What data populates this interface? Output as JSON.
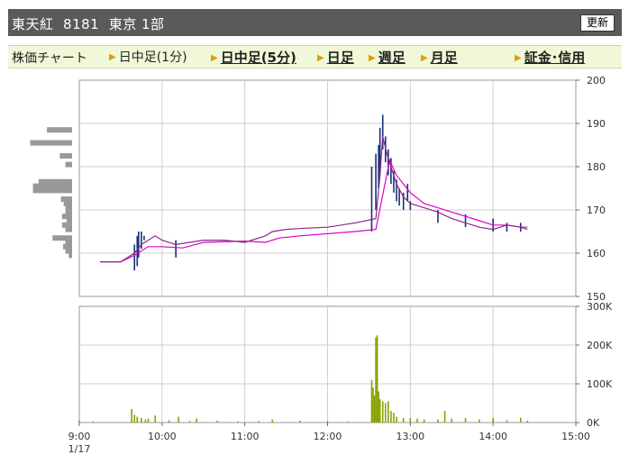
{
  "header": {
    "title": "東天紅  8181  東京 1部",
    "refresh_label": "更新"
  },
  "nav": {
    "label": "株価チャート",
    "items": [
      {
        "label": "日中足(1分)",
        "active": true
      },
      {
        "label": "日中足(5分)",
        "active": false
      },
      {
        "label": "日足",
        "active": false
      },
      {
        "label": "週足",
        "active": false
      },
      {
        "label": "月足",
        "active": false
      },
      {
        "label": "証金･信用",
        "active": false
      }
    ]
  },
  "colors": {
    "grid": "#cfcfcf",
    "frame": "#999999",
    "price_bar": "#1a2f7a",
    "ma_short": "#8a2a8a",
    "ma_long": "#e000c8",
    "volume": "#8aa000",
    "volume_profile": "#999999"
  },
  "chart_data": [
    {
      "type": "line",
      "name": "price",
      "y_ticks": [
        "200",
        "190",
        "180",
        "170",
        "160",
        "150"
      ],
      "ylim": [
        150,
        200
      ],
      "x_ticks": [
        "9:00",
        "10:00",
        "11:00",
        "12:00",
        "13:00",
        "14:00",
        "15:00"
      ],
      "date_label": "1/17",
      "ma_short": {
        "x": [
          "9:15",
          "9:30",
          "9:40",
          "9:45",
          "9:50",
          "9:55",
          "10:00",
          "10:10",
          "10:20",
          "10:30",
          "10:45",
          "11:00",
          "11:15",
          "11:20",
          "11:30",
          "11:45",
          "12:00",
          "12:20",
          "12:35",
          "12:38",
          "12:40",
          "12:43",
          "12:46",
          "12:50",
          "12:55",
          "13:00",
          "13:10",
          "13:20",
          "13:30",
          "13:40",
          "13:50",
          "14:00",
          "14:10",
          "14:20",
          "14:25"
        ],
        "y": [
          158,
          158,
          160,
          162,
          163,
          164,
          163,
          162,
          162.5,
          163,
          163,
          162.5,
          164,
          165,
          165.5,
          165.8,
          166,
          167,
          168,
          178,
          187,
          183,
          180,
          176,
          173,
          171.5,
          170.5,
          169.5,
          168,
          167,
          166,
          165.5,
          166.5,
          166,
          165.5
        ]
      },
      "ma_long": {
        "x": [
          "9:15",
          "9:30",
          "9:40",
          "9:50",
          "10:00",
          "10:15",
          "10:30",
          "11:00",
          "11:15",
          "11:25",
          "11:40",
          "12:00",
          "12:20",
          "12:35",
          "12:45",
          "12:50",
          "13:00",
          "13:10",
          "13:20",
          "13:30",
          "13:40",
          "13:50",
          "14:00",
          "14:10",
          "14:20",
          "14:25"
        ],
        "y": [
          158,
          158,
          159.5,
          161.5,
          161.5,
          161.2,
          162.5,
          162.8,
          162.5,
          163.5,
          164,
          164.5,
          165,
          165.5,
          181.5,
          178,
          174,
          171.5,
          170.5,
          169.5,
          168.5,
          167.5,
          166.5,
          166.5,
          166,
          166
        ]
      },
      "ticks": {
        "x": [
          "9:40",
          "9:42",
          "9:43",
          "9:45",
          "9:47",
          "10:10",
          "12:32",
          "12:35",
          "12:37",
          "12:38",
          "12:40",
          "12:42",
          "12:44",
          "12:46",
          "12:48",
          "12:50",
          "12:52",
          "12:55",
          "12:58",
          "13:00",
          "13:20",
          "13:40",
          "14:00",
          "14:10",
          "14:20"
        ],
        "low": [
          156,
          157,
          159,
          161,
          163,
          159,
          165,
          170,
          175,
          178,
          184,
          181,
          178,
          176,
          174,
          172,
          171,
          170,
          172,
          170,
          167,
          166,
          165,
          165,
          165
        ],
        "high": [
          162,
          164,
          165,
          165,
          164,
          163,
          180,
          183,
          185,
          189,
          192,
          187,
          184,
          182,
          179,
          177,
          175,
          174,
          176,
          172,
          170,
          169,
          168,
          167,
          167
        ]
      },
      "volume_profile": [
        {
          "price": 188.5,
          "weight": 0.45
        },
        {
          "price": 185.5,
          "weight": 0.75
        },
        {
          "price": 182.5,
          "weight": 0.22
        },
        {
          "price": 180.5,
          "weight": 0.12
        },
        {
          "price": 176.5,
          "weight": 0.6
        },
        {
          "price": 175.5,
          "weight": 0.7
        },
        {
          "price": 174.5,
          "weight": 0.7
        },
        {
          "price": 172.5,
          "weight": 0.2
        },
        {
          "price": 171.5,
          "weight": 0.15
        },
        {
          "price": 170.5,
          "weight": 0.12
        },
        {
          "price": 169.5,
          "weight": 0.12
        },
        {
          "price": 168.5,
          "weight": 0.18
        },
        {
          "price": 167.5,
          "weight": 0.1
        },
        {
          "price": 166.5,
          "weight": 0.18
        },
        {
          "price": 165.5,
          "weight": 0.12
        },
        {
          "price": 163.5,
          "weight": 0.35
        },
        {
          "price": 162.5,
          "weight": 0.12
        },
        {
          "price": 161.5,
          "weight": 0.16
        },
        {
          "price": 160.5,
          "weight": 0.12
        },
        {
          "price": 159.5,
          "weight": 0.06
        }
      ]
    },
    {
      "type": "bar",
      "name": "volume",
      "y_ticks": [
        "300K",
        "200K",
        "100K",
        "0K"
      ],
      "ylim": [
        0,
        300000
      ],
      "x": [
        "9:00",
        "9:10",
        "9:38",
        "9:40",
        "9:42",
        "9:45",
        "9:48",
        "9:50",
        "9:55",
        "10:05",
        "10:12",
        "10:20",
        "10:25",
        "10:40",
        "10:55",
        "11:10",
        "11:20",
        "11:40",
        "12:00",
        "12:15",
        "12:32",
        "12:33",
        "12:34",
        "12:35",
        "12:36",
        "12:37",
        "12:38",
        "12:40",
        "12:42",
        "12:44",
        "12:46",
        "12:48",
        "12:50",
        "12:55",
        "13:00",
        "13:05",
        "13:10",
        "13:20",
        "13:25",
        "13:30",
        "13:40",
        "13:50",
        "14:00",
        "14:10",
        "14:20",
        "14:25"
      ],
      "values": [
        5000,
        3000,
        35000,
        20000,
        15000,
        12000,
        8000,
        10000,
        18000,
        6000,
        15000,
        4000,
        10000,
        5000,
        3000,
        4000,
        8000,
        5000,
        4000,
        3000,
        110000,
        90000,
        70000,
        220000,
        225000,
        80000,
        60000,
        55000,
        50000,
        55000,
        30000,
        25000,
        15000,
        12000,
        12000,
        10000,
        8000,
        8000,
        30000,
        10000,
        12000,
        8000,
        12000,
        6000,
        12000,
        5000
      ]
    }
  ]
}
